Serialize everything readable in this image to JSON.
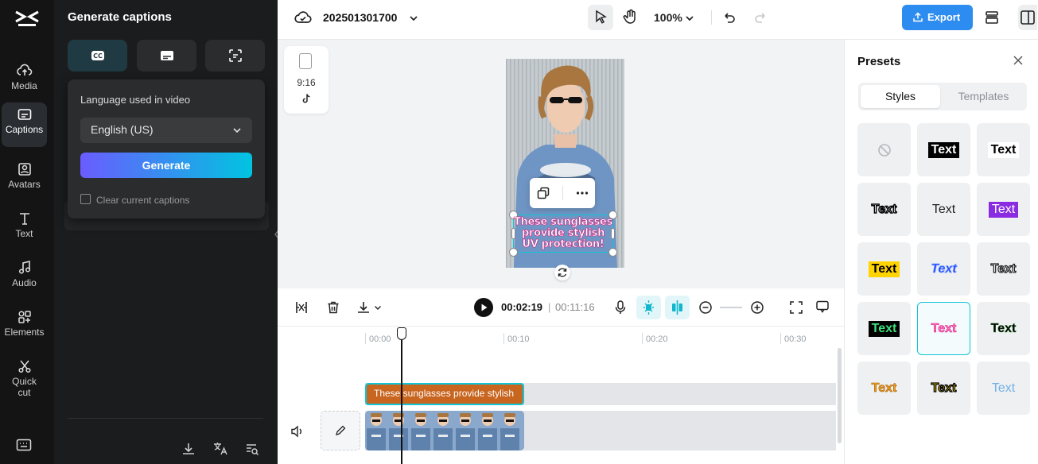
{
  "rail": {
    "items": [
      {
        "label": "Media"
      },
      {
        "label": "Captions"
      },
      {
        "label": "Avatars"
      },
      {
        "label": "Text"
      },
      {
        "label": "Audio"
      },
      {
        "label": "Elements"
      },
      {
        "label": "Quick cut"
      }
    ]
  },
  "panel": {
    "title": "Generate captions",
    "language_label": "Language used in video",
    "language_value": "English (US)",
    "generate_label": "Generate",
    "clear_label": "Clear current captions"
  },
  "topbar": {
    "project_name": "202501301700",
    "zoom": "100%",
    "export_label": "Export"
  },
  "canvas": {
    "ratio_label": "9:16",
    "caption_text": "These sunglasses provide stylish UV protection!"
  },
  "presets": {
    "title": "Presets",
    "tabs": [
      "Styles",
      "Templates"
    ],
    "tile_text": "Text"
  },
  "timeline": {
    "current_time": "00:02:19",
    "separator": "|",
    "total_time": "00:11:16",
    "ruler": [
      "00:00",
      "00:10",
      "00:20",
      "00:30"
    ],
    "caption_clip_text": "These sunglasses provide stylish"
  },
  "colors": {
    "accent": "#10c5d8",
    "export": "#2d8cf0",
    "generate_start": "#6a5cff",
    "generate_end": "#00c4e0",
    "caption_clip": "#c8651f"
  }
}
